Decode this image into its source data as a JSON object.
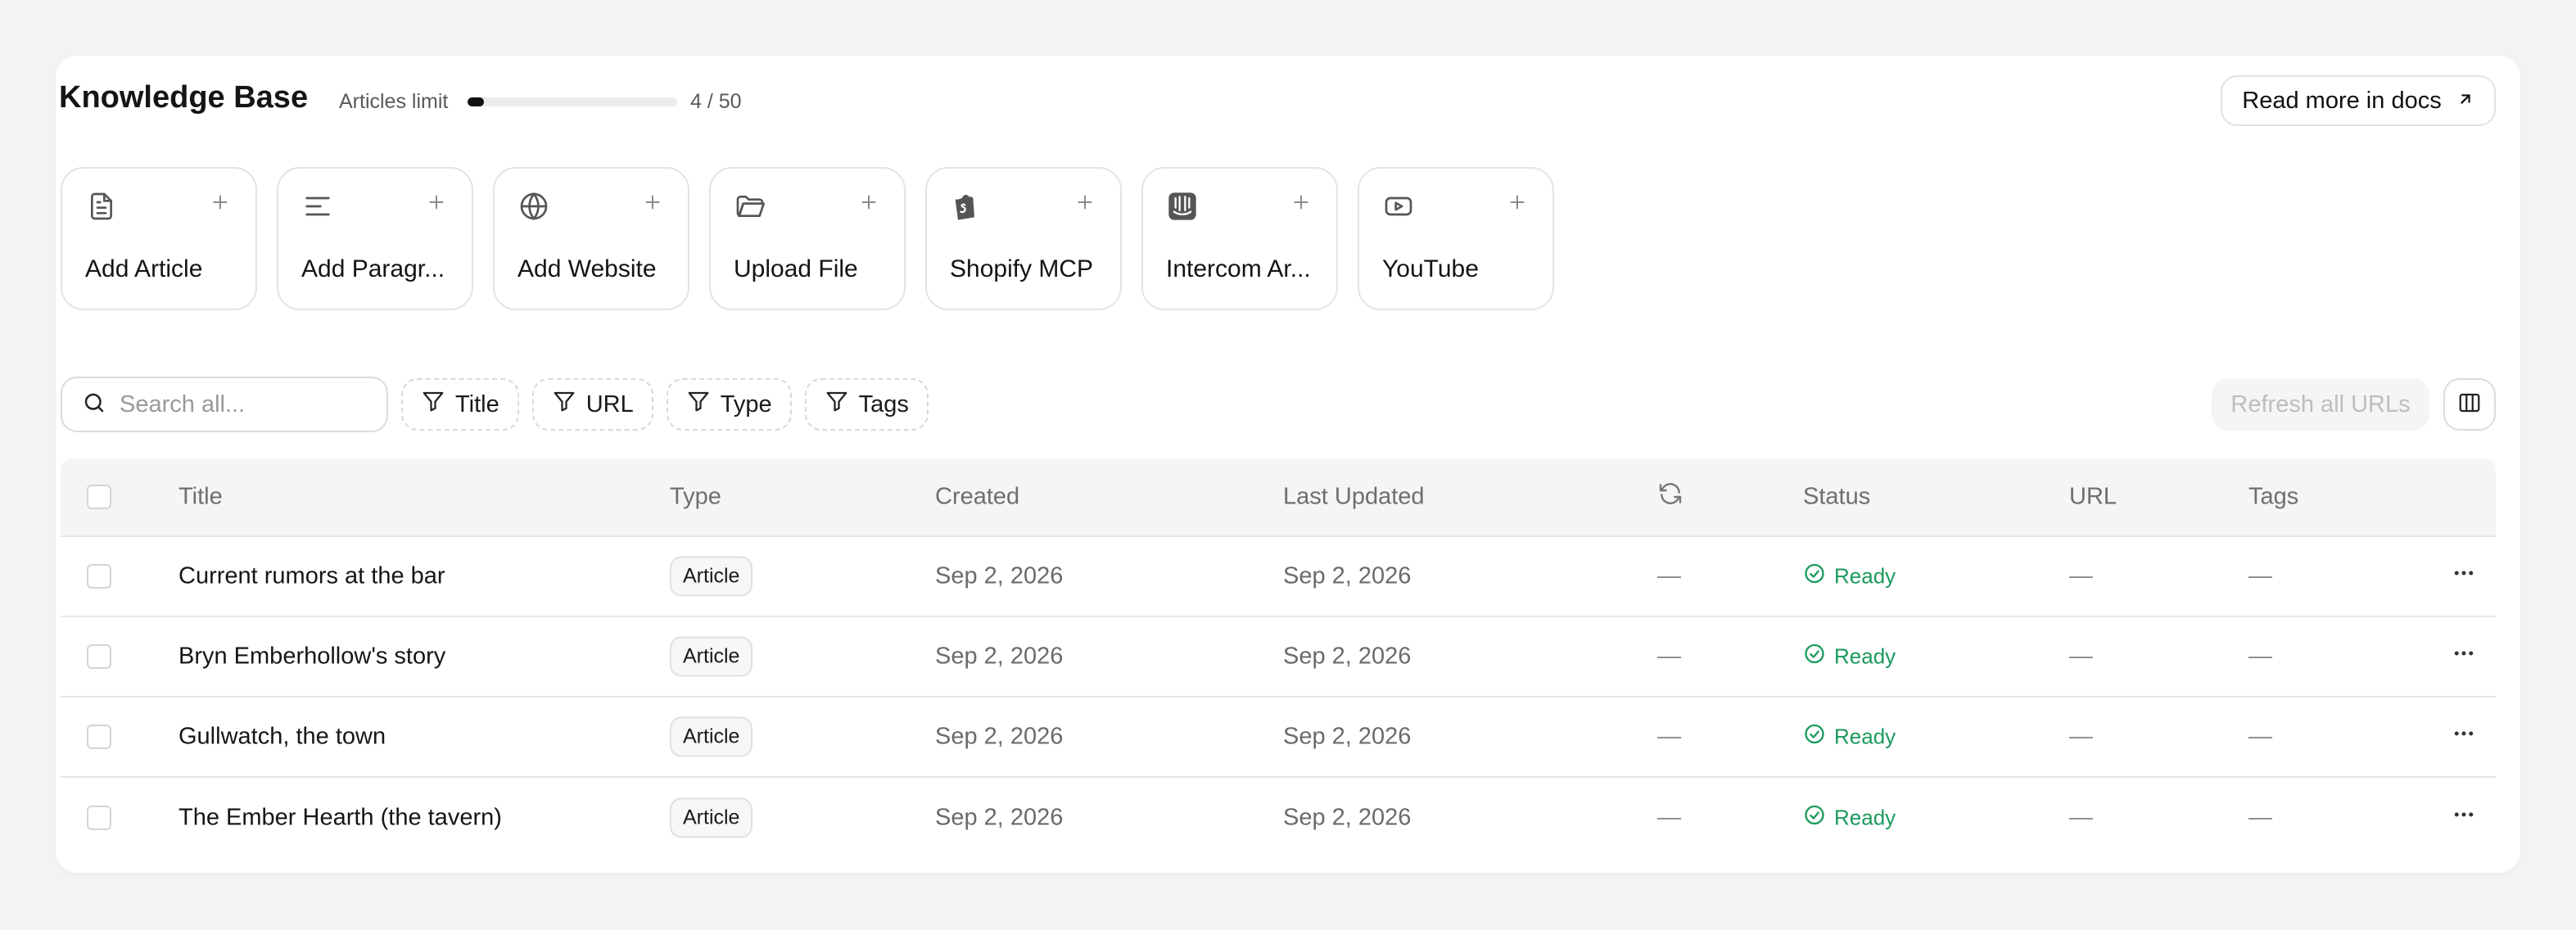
{
  "header": {
    "title": "Knowledge Base",
    "limit_label": "Articles limit",
    "limit_count": "4 / 50",
    "limit_progress": 0.08,
    "docs_button": "Read more in docs"
  },
  "sources": [
    {
      "label": "Add Article",
      "icon": "document-icon"
    },
    {
      "label": "Add Paragr...",
      "icon": "paragraph-icon"
    },
    {
      "label": "Add Website",
      "icon": "globe-icon"
    },
    {
      "label": "Upload File",
      "icon": "folder-icon"
    },
    {
      "label": "Shopify MCP",
      "icon": "shopify-icon"
    },
    {
      "label": "Intercom Ar...",
      "icon": "intercom-icon"
    },
    {
      "label": "YouTube",
      "icon": "youtube-icon"
    }
  ],
  "toolbar": {
    "search_placeholder": "Search all...",
    "filters": [
      "Title",
      "URL",
      "Type",
      "Tags"
    ],
    "refresh_label": "Refresh all URLs"
  },
  "table": {
    "columns": {
      "title": "Title",
      "type": "Type",
      "created": "Created",
      "updated": "Last Updated",
      "status": "Status",
      "url": "URL",
      "tags": "Tags"
    },
    "rows": [
      {
        "title": "Current rumors at the bar",
        "type": "Article",
        "created": "Sep 2, 2026",
        "updated": "Sep 2, 2026",
        "sync": "—",
        "status": "Ready",
        "url": "—",
        "tags": "—"
      },
      {
        "title": "Bryn Emberhollow's story",
        "type": "Article",
        "created": "Sep 2, 2026",
        "updated": "Sep 2, 2026",
        "sync": "—",
        "status": "Ready",
        "url": "—",
        "tags": "—"
      },
      {
        "title": "Gullwatch, the town",
        "type": "Article",
        "created": "Sep 2, 2026",
        "updated": "Sep 2, 2026",
        "sync": "—",
        "status": "Ready",
        "url": "—",
        "tags": "—"
      },
      {
        "title": "The Ember Hearth (the tavern)",
        "type": "Article",
        "created": "Sep 2, 2026",
        "updated": "Sep 2, 2026",
        "sync": "—",
        "status": "Ready",
        "url": "—",
        "tags": "—"
      }
    ]
  },
  "colors": {
    "status_ready": "#1b9a5c",
    "background": "#f3f3f2",
    "card": "#ffffff"
  }
}
